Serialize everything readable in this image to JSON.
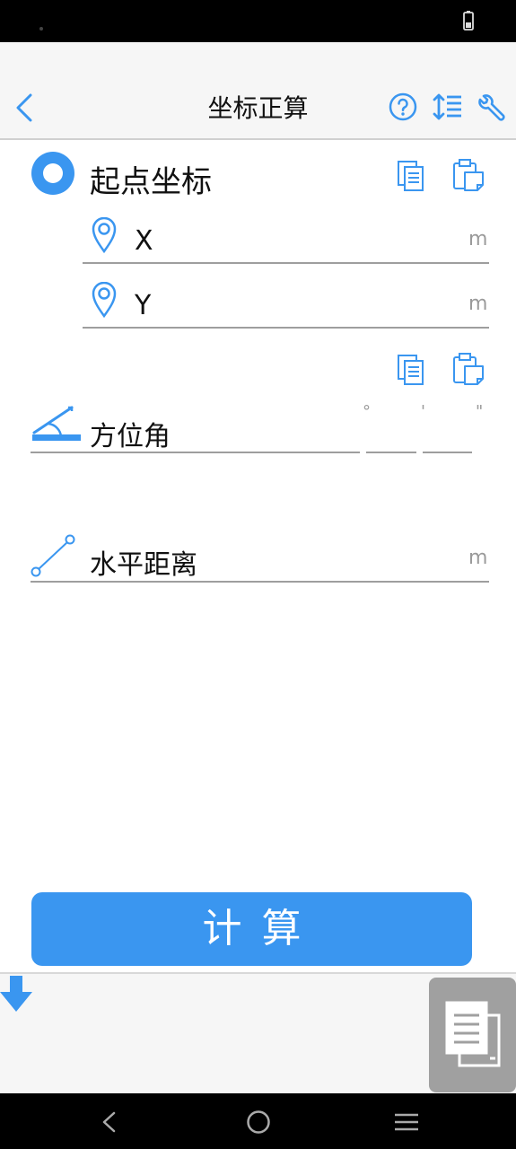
{
  "app_bar": {
    "title": "坐标正算"
  },
  "start_point": {
    "title": "起点坐标",
    "x_label": "X",
    "y_label": "Y",
    "unit": "m"
  },
  "azimuth": {
    "label": "方位角",
    "deg_symbol": "°",
    "min_symbol": "'",
    "sec_symbol": "\""
  },
  "distance": {
    "label": "水平距离",
    "unit": "m"
  },
  "calc_button": {
    "label": "计算"
  },
  "colors": {
    "accent": "#3a96f0",
    "status_bar": "#000000"
  },
  "icons": [
    "back-arrow-icon",
    "help-icon",
    "sort-icon",
    "wrench-icon",
    "copy-icon",
    "paste-icon",
    "location-pin-icon",
    "angle-icon",
    "line-segment-icon",
    "down-arrow-icon",
    "document-icon"
  ]
}
